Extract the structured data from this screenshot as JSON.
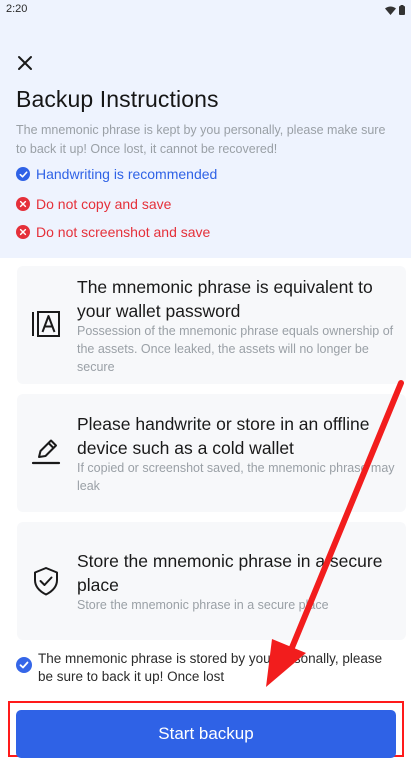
{
  "status_bar": {
    "time": "2:20"
  },
  "header": {
    "close_icon": "close-icon",
    "title": "Backup Instructions",
    "subtitle": "The mnemonic phrase is kept by you personally, please make sure to back it up! Once lost, it cannot be recovered!"
  },
  "notes": [
    {
      "text": "Handwriting is recommended",
      "type": "recommended"
    },
    {
      "text": "Do not copy and save",
      "type": "forbidden"
    },
    {
      "text": "Do not screenshot and save",
      "type": "forbidden"
    }
  ],
  "cards": [
    {
      "icon": "password-text-icon",
      "title": "The mnemonic phrase is equivalent to your wallet password",
      "description": "Possession of the mnemonic phrase equals ownership of the assets. Once leaked, the assets will no longer be secure"
    },
    {
      "icon": "pen-write-icon",
      "title": "Please handwrite or store in an offline device such as a cold wallet",
      "description": "If copied or screenshot saved, the mnemonic phrase may leak"
    },
    {
      "icon": "shield-check-icon",
      "title": "Store the mnemonic phrase in a secure place",
      "description": "Store the mnemonic phrase in a secure place"
    }
  ],
  "agreement": {
    "checked": true,
    "text": "The mnemonic phrase is stored by you personally, please be sure to back it up! Once lost"
  },
  "footer": {
    "start_label": "Start backup"
  },
  "colors": {
    "primary": "#2f62e6",
    "danger": "#e5303a",
    "panel_background": "#eef3fe",
    "card_background": "#f7f8fa",
    "annotation": "#ff1a1a"
  }
}
